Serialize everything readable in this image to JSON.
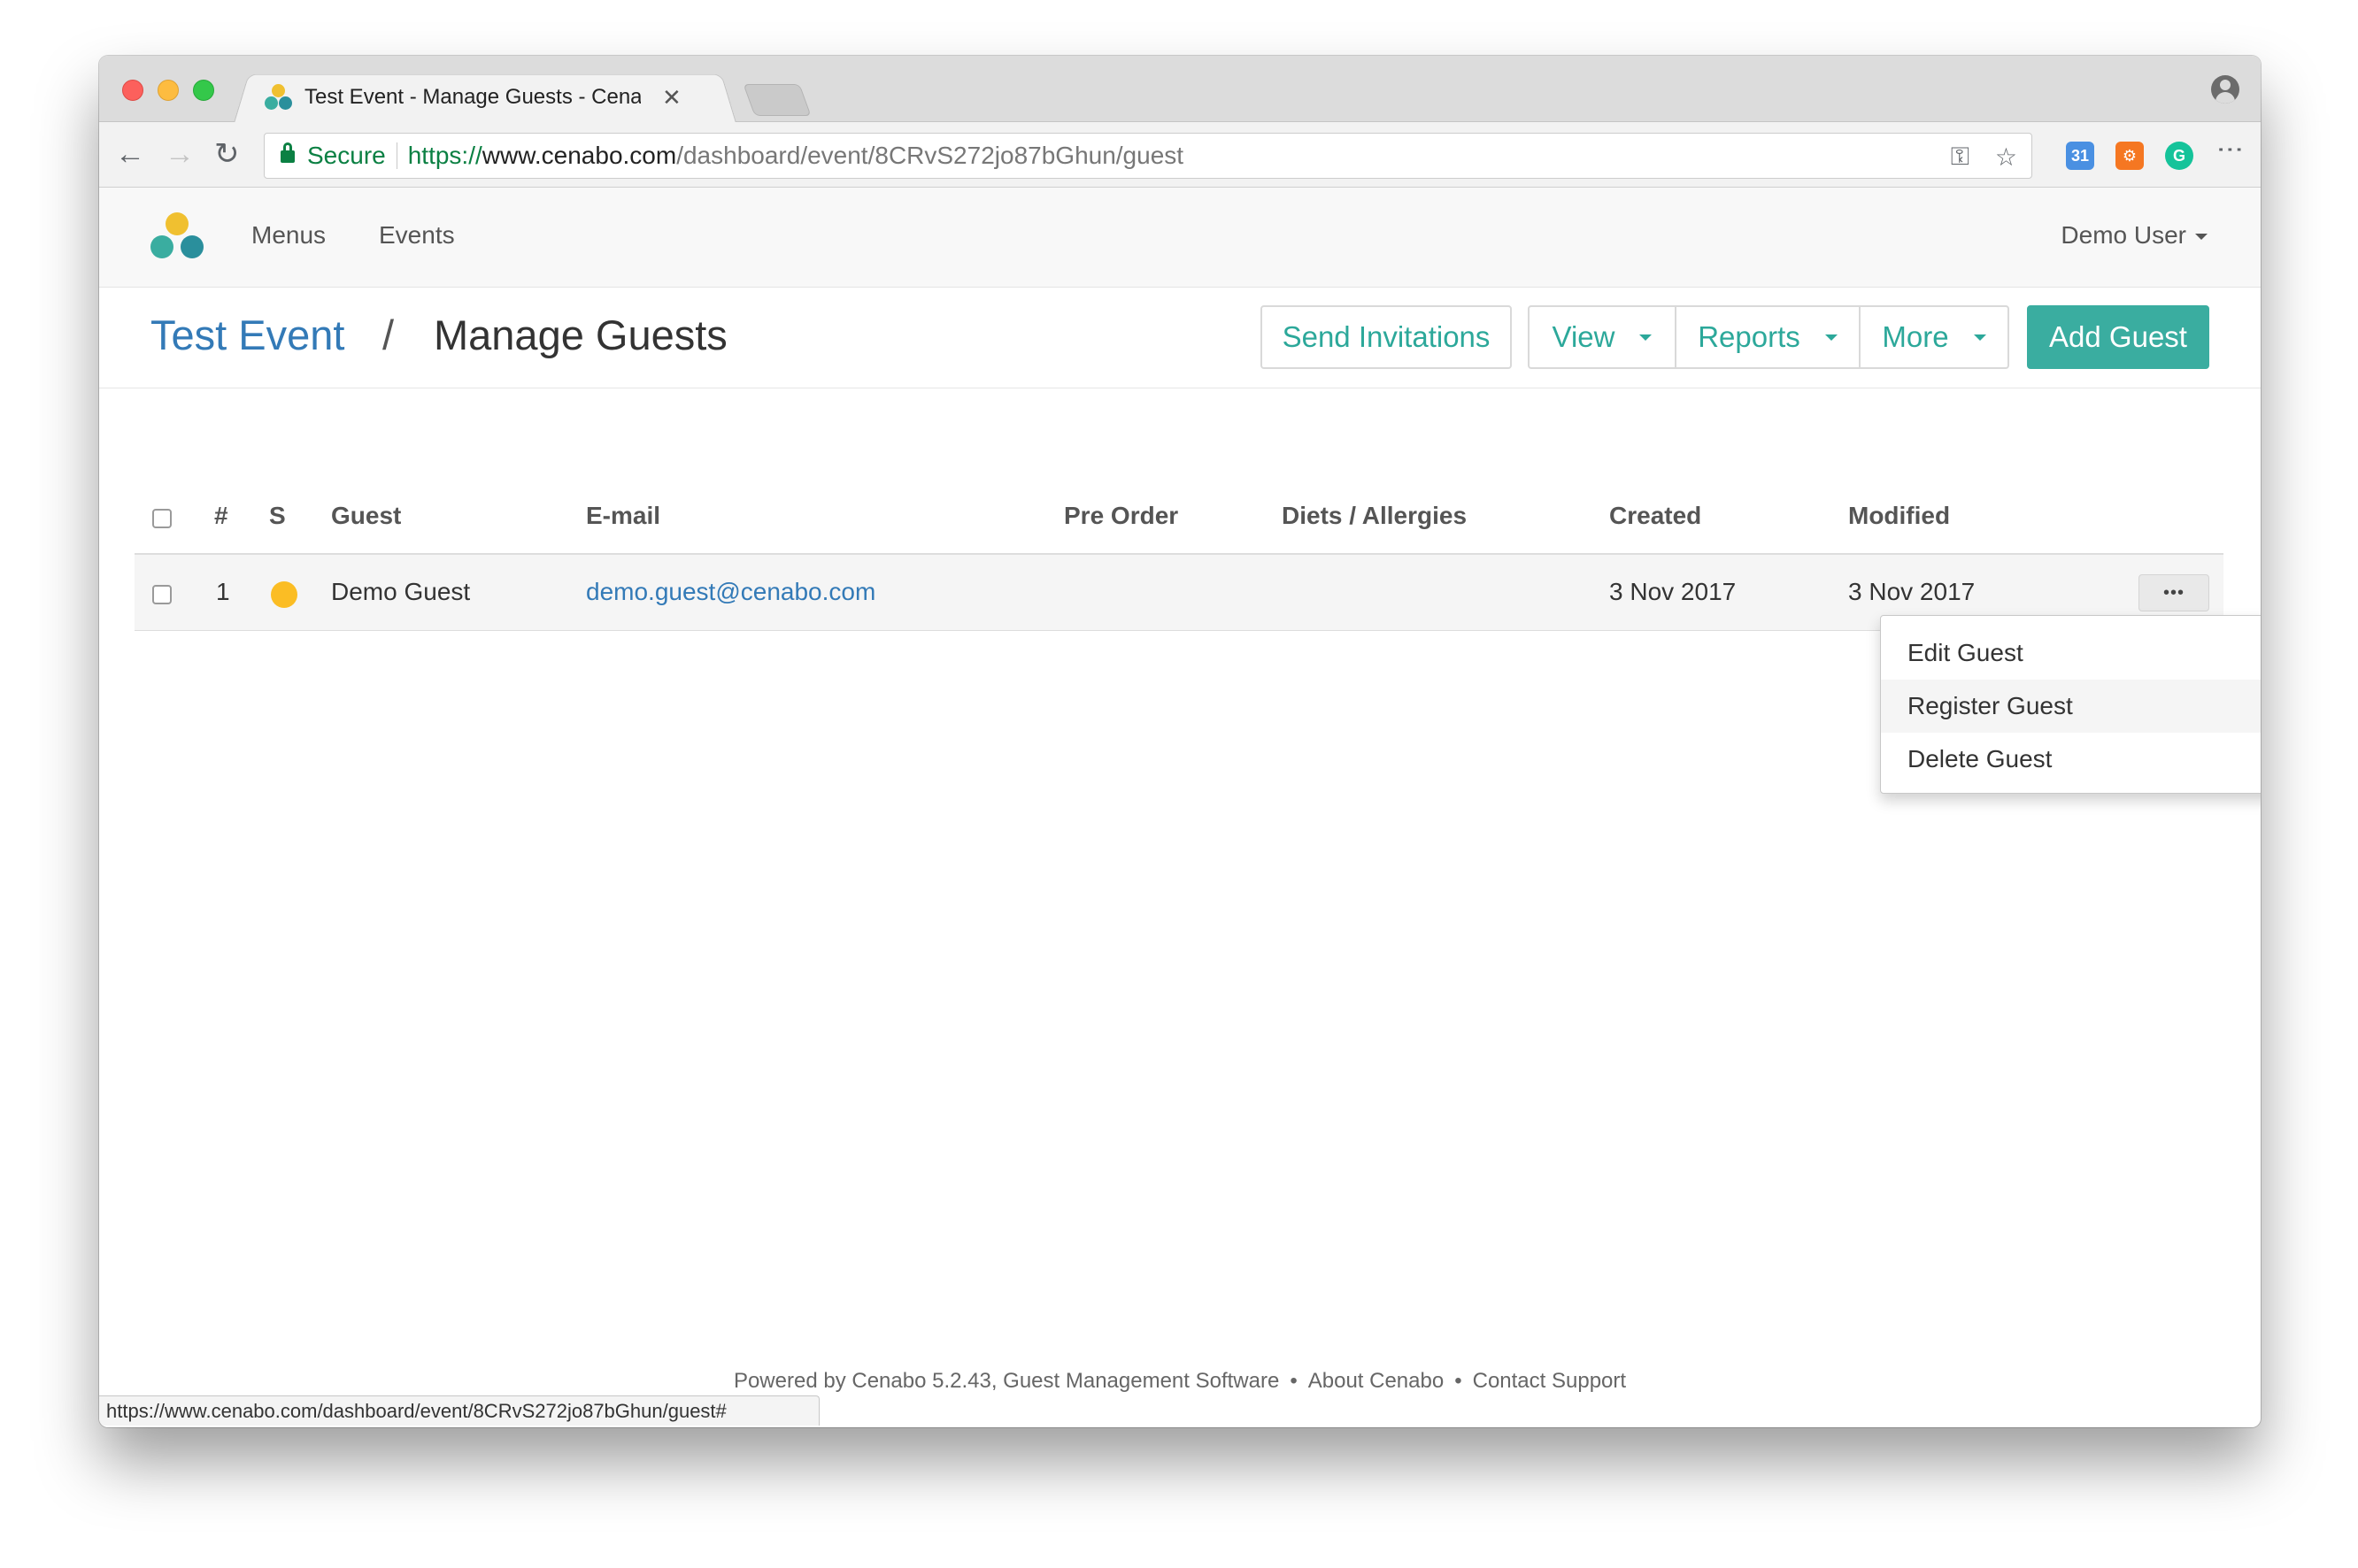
{
  "browser": {
    "tab_title": "Test Event - Manage Guests - Cenabo",
    "tab_close": "✕",
    "secure_label": "Secure",
    "url_scheme": "https://",
    "url_host": "www.cenabo.com",
    "url_path": "/dashboard/event/8CRvS272jo87bGhun/guest",
    "back_icon": "←",
    "forward_icon": "→",
    "reload_icon": "↻",
    "key_icon": "⚿",
    "star_icon": "☆",
    "menu_icon": "⋮",
    "status_url": "https://www.cenabo.com/dashboard/event/8CRvS272jo87bGhun/guest#"
  },
  "colors": {
    "logo_top": "#f0c030",
    "logo_left": "#3aada0",
    "logo_right": "#2a8f9c",
    "accent": "#3aada0",
    "status_pending": "#fbbd24"
  },
  "appnav": {
    "links": [
      "Menus",
      "Events"
    ],
    "user": "Demo User"
  },
  "header": {
    "event_name": "Test Event",
    "separator": "/",
    "page_title": "Manage Guests",
    "buttons": {
      "send_invitations": "Send Invitations",
      "view": "View",
      "reports": "Reports",
      "more": "More",
      "add_guest": "Add Guest"
    }
  },
  "table": {
    "columns": {
      "number": "#",
      "status": "S",
      "guest": "Guest",
      "email": "E-mail",
      "pre_order": "Pre Order",
      "diets": "Diets / Allergies",
      "created": "Created",
      "modified": "Modified"
    },
    "rows": [
      {
        "number": "1",
        "status": "pending",
        "guest": "Demo Guest",
        "email": "demo.guest@cenabo.com",
        "pre_order": "",
        "diets": "",
        "created": "3 Nov 2017",
        "modified": "3 Nov 2017"
      }
    ],
    "row_actions": "•••"
  },
  "dropdown": {
    "items": [
      "Edit Guest",
      "Register Guest",
      "Delete Guest"
    ],
    "active_index": 1
  },
  "footer": {
    "powered": "Powered by Cenabo 5.2.43, Guest Management Software",
    "bullet": "•",
    "about": "About Cenabo",
    "support": "Contact Support"
  }
}
